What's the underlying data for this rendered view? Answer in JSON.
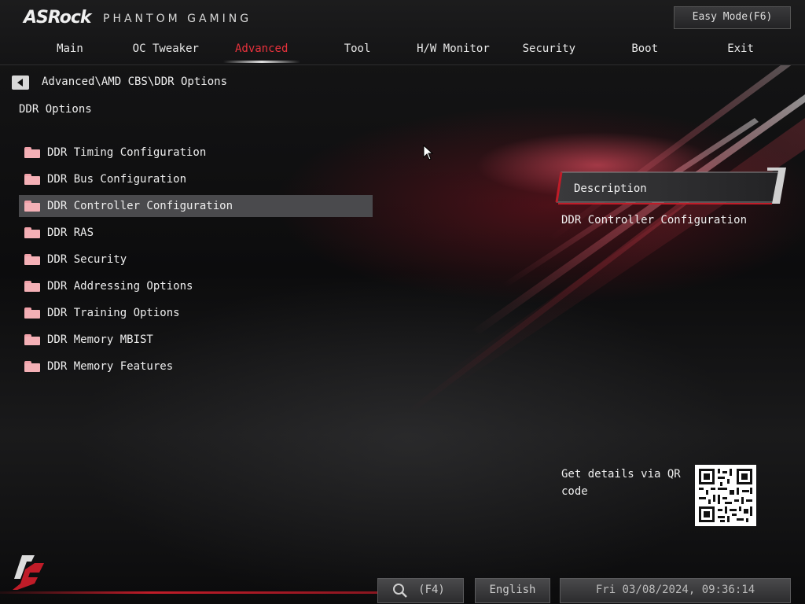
{
  "header": {
    "logo": "ASRock",
    "subtitle": "PHANTOM GAMING",
    "easy_mode_label": "Easy Mode(F6)"
  },
  "tabs": [
    {
      "label": "Main"
    },
    {
      "label": "OC Tweaker"
    },
    {
      "label": "Advanced",
      "active": true
    },
    {
      "label": "Tool"
    },
    {
      "label": "H/W Monitor"
    },
    {
      "label": "Security"
    },
    {
      "label": "Boot"
    },
    {
      "label": "Exit"
    }
  ],
  "breadcrumb": "Advanced\\AMD CBS\\DDR Options",
  "page_title": "DDR Options",
  "menu": {
    "items": [
      {
        "label": "DDR Timing Configuration",
        "icon": "folder-icon"
      },
      {
        "label": "DDR Bus Configuration",
        "icon": "folder-icon"
      },
      {
        "label": "DDR Controller Configuration",
        "icon": "folder-icon",
        "selected": true
      },
      {
        "label": "DDR RAS",
        "icon": "folder-icon"
      },
      {
        "label": "DDR Security",
        "icon": "folder-icon"
      },
      {
        "label": "DDR Addressing Options",
        "icon": "folder-icon"
      },
      {
        "label": "DDR Training Options",
        "icon": "folder-icon"
      },
      {
        "label": "DDR Memory MBIST",
        "icon": "folder-icon"
      },
      {
        "label": "DDR Memory Features",
        "icon": "folder-icon"
      }
    ]
  },
  "description": {
    "title": "Description",
    "text": "DDR Controller Configuration"
  },
  "qr": {
    "text": "Get details via QR code"
  },
  "footer": {
    "search_label": "(F4)",
    "language": "English",
    "datetime": "Fri 03/08/2024, 09:36:14"
  },
  "colors": {
    "accent": "#e8323c",
    "selected_row": "#4a4a4d",
    "folder": "#f4b0b6"
  }
}
